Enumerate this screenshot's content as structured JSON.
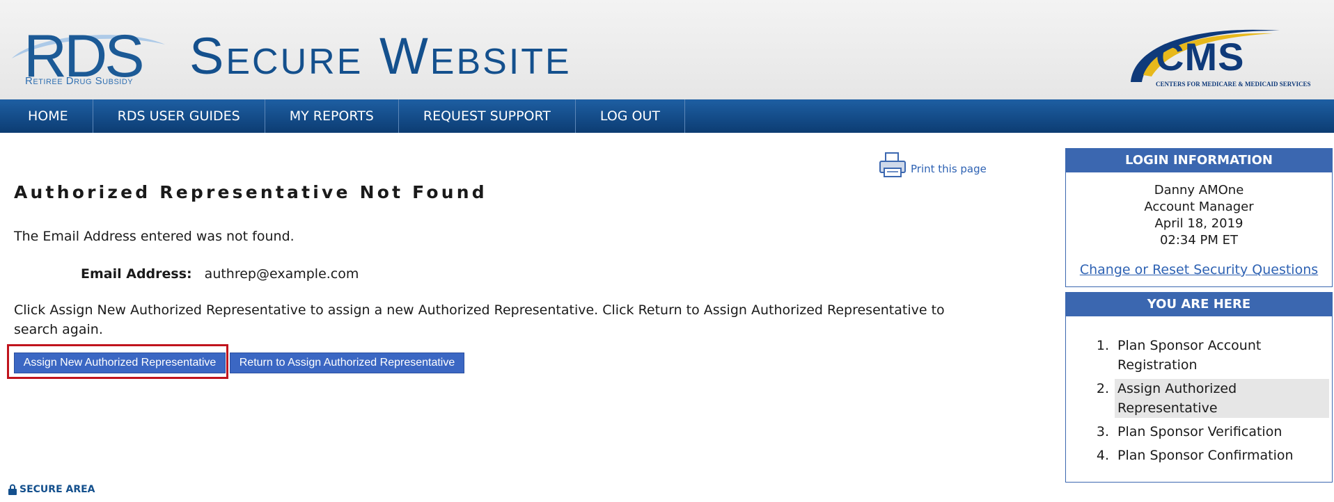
{
  "header": {
    "logo_text": "RDS",
    "logo_subtitle": "Retiree Drug Subsidy",
    "site_title": "Secure Website",
    "cms_logo_text": "CMS",
    "cms_logo_subtitle": "CENTERS FOR MEDICARE & MEDICAID SERVICES"
  },
  "nav": {
    "items": [
      {
        "label": "HOME"
      },
      {
        "label": "RDS USER GUIDES"
      },
      {
        "label": "MY REPORTS"
      },
      {
        "label": "REQUEST SUPPORT"
      },
      {
        "label": "LOG OUT"
      }
    ]
  },
  "main": {
    "print_label": "Print this page",
    "title": "Authorized Representative Not Found",
    "message": "The Email Address entered was not found.",
    "email_label": "Email Address:",
    "email_value": "authrep@example.com",
    "instructions": "Click Assign New Authorized Representative to assign a new Authorized Representative. Click Return to Assign Authorized Representative to search again.",
    "assign_button": "Assign New Authorized Representative",
    "return_button": "Return to Assign Authorized Representative",
    "secure_label": "SECURE AREA"
  },
  "login_info": {
    "heading": "LOGIN INFORMATION",
    "name": "Danny AMOne",
    "role": "Account Manager",
    "date": "April 18, 2019",
    "time": "02:34 PM ET",
    "link": "Change or Reset Security Questions"
  },
  "you_are_here": {
    "heading": "YOU ARE HERE",
    "steps": [
      {
        "num": "1.",
        "label": "Plan Sponsor Account Registration"
      },
      {
        "num": "2.",
        "label": "Assign Authorized Representative"
      },
      {
        "num": "3.",
        "label": "Plan Sponsor Verification"
      },
      {
        "num": "4.",
        "label": "Plan Sponsor Confirmation"
      }
    ],
    "active_step": 2
  },
  "colors": {
    "nav_bg": "#0c3c72",
    "panel_head": "#3b67b0",
    "button_bg": "#3b67c3",
    "highlight_border": "#c0141d"
  }
}
